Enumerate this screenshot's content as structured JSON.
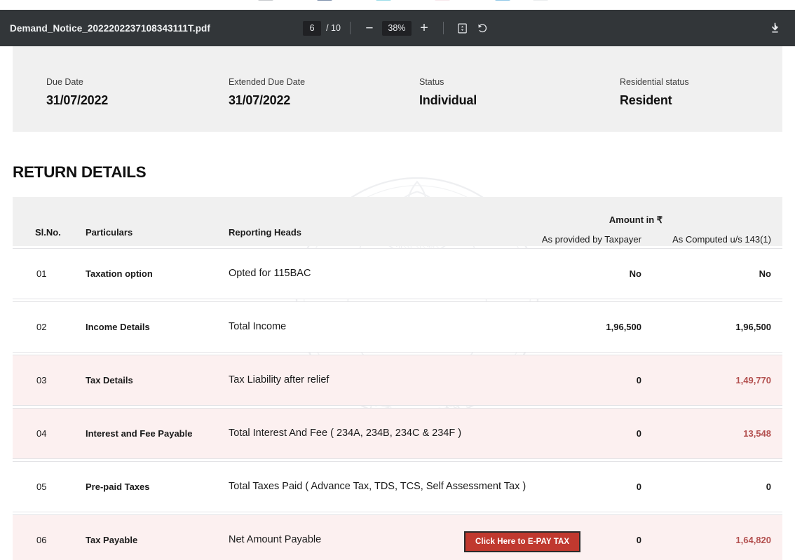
{
  "browser": {
    "tab_fragments": [
      "#9aa0a6",
      "#1a3a6b",
      "#4fc3d9",
      "#e8b4c0",
      "#3d9fd6",
      "#bdc3c7"
    ]
  },
  "toolbar": {
    "file_name": "Demand_Notice_20222022371083431 11T.pdf",
    "file_name_display": "Demand_Notice_2022202237108343111T.pdf",
    "current_page": "6",
    "page_separator": "/ 10",
    "total_pages": "10",
    "zoom_out_label": "−",
    "zoom_level": "38%",
    "zoom_in_label": "+",
    "fit_label": "fit-to-page",
    "rotate_label": "rotate",
    "download_label": "download"
  },
  "document": {
    "watermark_text": "INCOME TAX DEPARTMENT",
    "info_fields": [
      {
        "label": "Due Date",
        "value": "31/07/2022"
      },
      {
        "label": "Extended Due Date",
        "value": "31/07/2022"
      },
      {
        "label": "Status",
        "value": "Individual"
      },
      {
        "label": "Residential status",
        "value": "Resident"
      }
    ],
    "section_title": "RETURN DETAILS",
    "table": {
      "headers": {
        "sl_no": "Sl.No.",
        "particulars": "Particulars",
        "reporting_heads": "Reporting Heads",
        "amount_in": "Amount in ₹",
        "as_provided": "As provided by Taxpayer",
        "as_computed": "As Computed u/s 143(1)"
      },
      "rows": [
        {
          "sl_no": "01",
          "particulars": "Taxation option",
          "reporting_head": "Opted for 115BAC",
          "as_provided": "No",
          "as_computed": "No",
          "highlight": false,
          "computed_red": false
        },
        {
          "sl_no": "02",
          "particulars": "Income Details",
          "reporting_head": "Total Income",
          "as_provided": "1,96,500",
          "as_computed": "1,96,500",
          "highlight": false,
          "computed_red": false
        },
        {
          "sl_no": "03",
          "particulars": "Tax Details",
          "reporting_head": "Tax Liability after relief",
          "as_provided": "0",
          "as_computed": "1,49,770",
          "highlight": true,
          "computed_red": true
        },
        {
          "sl_no": "04",
          "particulars": "Interest and Fee Payable",
          "reporting_head": "Total Interest And Fee ( 234A, 234B, 234C & 234F )",
          "as_provided": "0",
          "as_computed": "13,548",
          "highlight": true,
          "computed_red": true
        },
        {
          "sl_no": "05",
          "particulars": "Pre-paid Taxes",
          "reporting_head": "Total Taxes Paid ( Advance Tax, TDS, TCS, Self Assessment Tax )",
          "as_provided": "0",
          "as_computed": "0",
          "highlight": false,
          "computed_red": false
        },
        {
          "sl_no": "06",
          "particulars": "Tax Payable",
          "reporting_head": "Net Amount Payable",
          "as_provided": "0",
          "as_computed": "1,64,820",
          "highlight": true,
          "computed_red": true,
          "button": "Click Here to E-PAY TAX"
        }
      ]
    }
  },
  "colors": {
    "toolbar_bg": "#323639",
    "panel_bg": "#f0f0f0",
    "row_highlight": "#fcf0f0",
    "amount_red": "#b3504f",
    "epay_button_bg": "#c0392f"
  }
}
